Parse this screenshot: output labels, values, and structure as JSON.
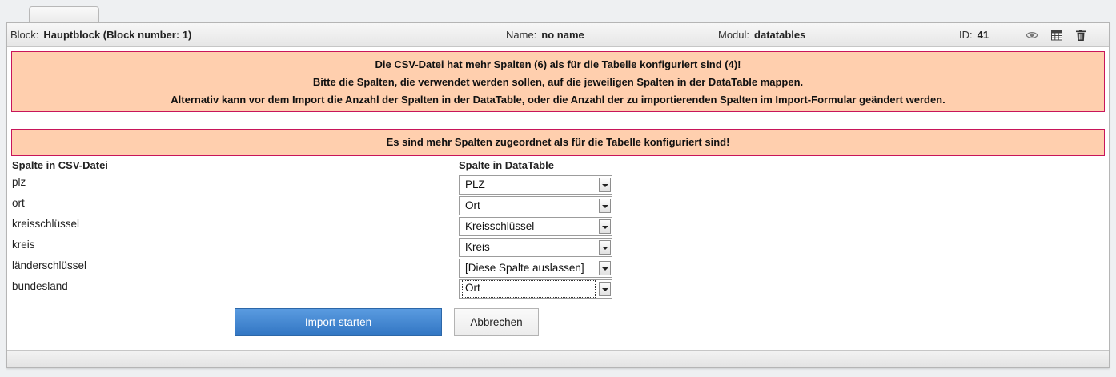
{
  "header": {
    "block_label": "Block:",
    "block_value": "Hauptblock (Block number: 1)",
    "name_label": "Name:",
    "name_value": "no name",
    "modul_label": "Modul:",
    "modul_value": "datatables",
    "id_label": "ID:",
    "id_value": "41",
    "icons": [
      "eye-icon",
      "table-icon",
      "trash-icon"
    ]
  },
  "alerts": {
    "columns_mismatch": [
      "Die CSV-Datei hat mehr Spalten (6) als für die Tabelle konfiguriert sind (4)!",
      "Bitte die Spalten, die verwendet werden sollen, auf die jeweiligen Spalten in der DataTable mappen.",
      "Alternativ kann vor dem Import die Anzahl der Spalten in der DataTable, oder die Anzahl der zu importierenden Spalten im Import-Formular geändert werden."
    ],
    "too_many_assigned": "Es sind mehr Spalten zugeordnet als für die Tabelle konfiguriert sind!"
  },
  "mapping": {
    "col_csv_header": "Spalte in CSV-Datei",
    "col_dt_header": "Spalte in DataTable",
    "rows": [
      {
        "csv": "plz",
        "dt": "PLZ"
      },
      {
        "csv": "ort",
        "dt": "Ort"
      },
      {
        "csv": "kreisschlüssel",
        "dt": "Kreisschlüssel"
      },
      {
        "csv": "kreis",
        "dt": "Kreis"
      },
      {
        "csv": "länderschlüssel",
        "dt": "[Diese Spalte auslassen]"
      },
      {
        "csv": "bundesland",
        "dt": "Ort"
      }
    ]
  },
  "buttons": {
    "import_label": "Import starten",
    "cancel_label": "Abbrechen"
  },
  "colors": {
    "alert_bg": "#ffcfae",
    "alert_border": "#c8155a",
    "primary_button": "#3f86d2"
  }
}
